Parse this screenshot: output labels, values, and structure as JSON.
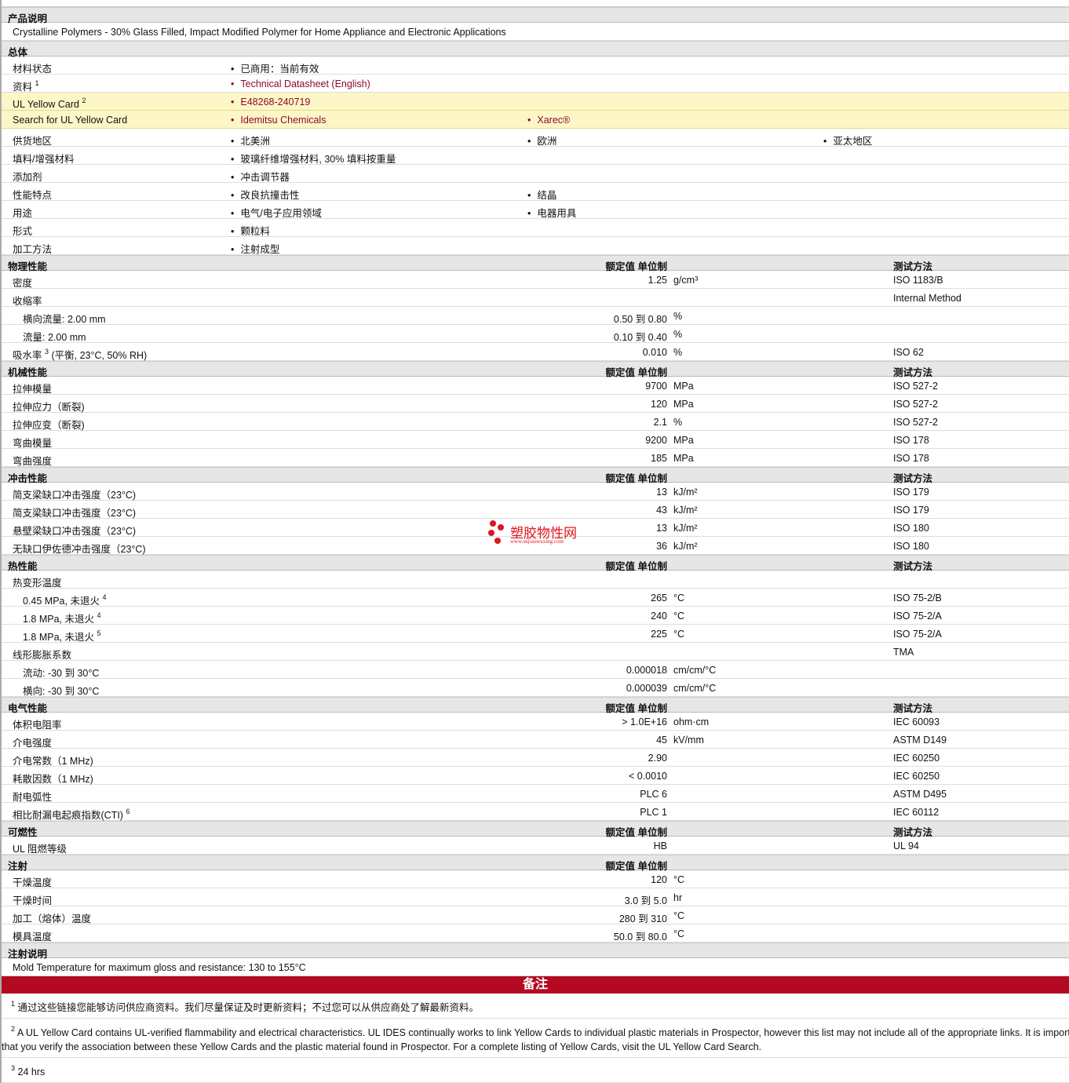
{
  "sections": [
    {
      "title": "产品说明",
      "kind": "text",
      "rows": [
        {
          "label": "Crystalline Polymers - 30% Glass Filled, Impact Modified Polymer for Home Appliance and Electronic Applications"
        }
      ]
    },
    {
      "title": "总体",
      "kind": "bullets",
      "rows": [
        {
          "label": "材料状态",
          "items": [
            {
              "text": "已商用：当前有效"
            }
          ]
        },
        {
          "label": "资料",
          "sup": "1",
          "items": [
            {
              "text": "Technical Datasheet (English)",
              "link": true
            }
          ]
        },
        {
          "label": "UL Yellow Card",
          "sup": "2",
          "highlight": true,
          "items": [
            {
              "text": "E48268-240719",
              "link": true
            }
          ]
        },
        {
          "label": "Search for UL Yellow Card",
          "highlight": true,
          "items": [
            {
              "text": "Idemitsu Chemicals",
              "link": true
            },
            {
              "text": "Xarec®",
              "link": true
            }
          ]
        },
        {
          "label": "供货地区",
          "items": [
            {
              "text": "北美洲"
            },
            {
              "text": "欧洲"
            },
            {
              "text": "亚太地区"
            }
          ]
        },
        {
          "label": "填料/增强材料",
          "items": [
            {
              "text": "玻璃纤维增强材料, 30% 填料按重量"
            }
          ]
        },
        {
          "label": "添加剂",
          "items": [
            {
              "text": "冲击调节器"
            }
          ]
        },
        {
          "label": "性能特点",
          "items": [
            {
              "text": "改良抗撞击性"
            },
            {
              "text": "结晶"
            }
          ]
        },
        {
          "label": "用途",
          "items": [
            {
              "text": "电气/电子应用领域"
            },
            {
              "text": "电器用具"
            }
          ]
        },
        {
          "label": "形式",
          "items": [
            {
              "text": "颗粒料"
            }
          ]
        },
        {
          "label": "加工方法",
          "items": [
            {
              "text": "注射成型"
            }
          ]
        }
      ]
    },
    {
      "title": "物理性能",
      "kind": "props",
      "value_header": "额定值 单位制",
      "method_header": "测试方法",
      "rows": [
        {
          "label": "密度",
          "value": "1.25",
          "unit": "g/cm³",
          "method": "ISO 1183/B"
        },
        {
          "label": "收缩率",
          "method": "Internal Method"
        },
        {
          "label": "横向流量: 2.00 mm",
          "indent": true,
          "value": "0.50 到  0.80",
          "unit": "%"
        },
        {
          "label": "流量: 2.00 mm",
          "indent": true,
          "value": "0.10 到  0.40",
          "unit": "%"
        },
        {
          "label": "吸水率",
          "sup": "3",
          "label2": "(平衡, 23°C, 50% RH)",
          "value": "0.010",
          "unit": "%",
          "method": "ISO 62"
        }
      ]
    },
    {
      "title": "机械性能",
      "kind": "props",
      "value_header": "额定值 单位制",
      "method_header": "测试方法",
      "rows": [
        {
          "label": "拉伸模量",
          "value": "9700",
          "unit": "MPa",
          "method": "ISO 527-2"
        },
        {
          "label": "拉伸应力（断裂)",
          "value": "120",
          "unit": "MPa",
          "method": "ISO 527-2"
        },
        {
          "label": "拉伸应变（断裂)",
          "value": "2.1",
          "unit": "%",
          "method": "ISO 527-2"
        },
        {
          "label": "弯曲模量",
          "value": "9200",
          "unit": "MPa",
          "method": "ISO 178"
        },
        {
          "label": "弯曲强度",
          "value": "185",
          "unit": "MPa",
          "method": "ISO 178"
        }
      ]
    },
    {
      "title": "冲击性能",
      "kind": "props",
      "value_header": "额定值 单位制",
      "method_header": "测试方法",
      "rows": [
        {
          "label": "简支梁缺口冲击强度（23°C)",
          "value": "13",
          "unit": "kJ/m²",
          "method": "ISO 179"
        },
        {
          "label": "简支梁缺口冲击强度（23°C)",
          "value": "43",
          "unit": "kJ/m²",
          "method": "ISO 179"
        },
        {
          "label": "悬壁梁缺口冲击强度（23°C)",
          "value": "13",
          "unit": "kJ/m²",
          "method": "ISO 180"
        },
        {
          "label": "无缺口伊佐德冲击强度（23°C)",
          "value": "36",
          "unit": "kJ/m²",
          "method": "ISO 180"
        }
      ]
    },
    {
      "title": "热性能",
      "kind": "props",
      "value_header": "额定值 单位制",
      "method_header": "测试方法",
      "rows": [
        {
          "label": "热变形温度"
        },
        {
          "label": "0.45 MPa, 未退火",
          "sup": "4",
          "indent": true,
          "value": "265",
          "unit": "°C",
          "method": "ISO 75-2/B"
        },
        {
          "label": "1.8 MPa, 未退火",
          "sup": "4",
          "indent": true,
          "value": "240",
          "unit": "°C",
          "method": "ISO 75-2/A"
        },
        {
          "label": "1.8 MPa, 未退火",
          "sup": "5",
          "indent": true,
          "value": "225",
          "unit": "°C",
          "method": "ISO 75-2/A"
        },
        {
          "label": "线形膨胀系数",
          "method": "TMA"
        },
        {
          "label": "流动: -30 到  30°C",
          "indent": true,
          "value": "0.000018",
          "unit": "cm/cm/°C"
        },
        {
          "label": "横向: -30 到  30°C",
          "indent": true,
          "value": "0.000039",
          "unit": "cm/cm/°C"
        }
      ]
    },
    {
      "title": "电气性能",
      "kind": "props",
      "value_header": "额定值 单位制",
      "method_header": "测试方法",
      "rows": [
        {
          "label": "体积电阻率",
          "value": "> 1.0E+16",
          "unit": "ohm·cm",
          "method": "IEC 60093"
        },
        {
          "label": "介电强度",
          "value": "45",
          "unit": "kV/mm",
          "method": "ASTM D149"
        },
        {
          "label": "介电常数（1 MHz)",
          "value": "2.90",
          "method": "IEC 60250"
        },
        {
          "label": "耗散因数（1 MHz)",
          "value": "< 0.0010",
          "method": "IEC 60250"
        },
        {
          "label": "耐电弧性",
          "value": "PLC 6",
          "method": "ASTM D495"
        },
        {
          "label": "相比耐漏电起痕指数(CTI)",
          "sup": "6",
          "value": "PLC 1",
          "method": "IEC 60112"
        }
      ]
    },
    {
      "title": "可燃性",
      "kind": "props",
      "value_header": "额定值 单位制",
      "method_header": "测试方法",
      "rows": [
        {
          "label": "UL 阻燃等级",
          "value": "HB",
          "method": "UL 94"
        }
      ]
    },
    {
      "title": "注射",
      "kind": "props",
      "value_header": "额定值 单位制",
      "rows": [
        {
          "label": "干燥温度",
          "value": "120",
          "unit": "°C"
        },
        {
          "label": "干燥时间",
          "value": "3.0 到  5.0",
          "unit": "hr"
        },
        {
          "label": "加工（熔体）温度",
          "value": "280 到  310",
          "unit": "°C"
        },
        {
          "label": "模具温度",
          "value": "50.0 到  80.0",
          "unit": "°C"
        }
      ]
    },
    {
      "title": "注射说明",
      "kind": "text",
      "rows": [
        {
          "label": "Mold Temperature for maximum gloss and resistance: 130 to 155°C"
        }
      ]
    }
  ],
  "notes": {
    "title": "备注",
    "items": [
      {
        "n": "1",
        "text": "通过这些链接您能够访问供应商资料。我们尽量保证及时更新资料；不过您可以从供应商处了解最新资料。"
      },
      {
        "n": "2",
        "text": "A UL Yellow Card contains UL-verified flammability and electrical characteristics. UL IDES continually works to link Yellow Cards to individual plastic materials in Prospector, however this list may not include all of the appropriate links. It is important that you verify the association between these Yellow Cards and the plastic material found in Prospector. For a complete listing of Yellow Cards, visit the UL Yellow Card Search.",
        "wrap": true
      },
      {
        "n": "3",
        "text": "24 hrs"
      }
    ]
  },
  "watermark": {
    "name": "塑胶物性网",
    "url": "www.sujiaowuxing.com"
  },
  "colors": {
    "link": "#8b0a2a",
    "notes_bar": "#b30a22",
    "highlight": "#fdf7c7",
    "section": "#e6e6e6"
  }
}
